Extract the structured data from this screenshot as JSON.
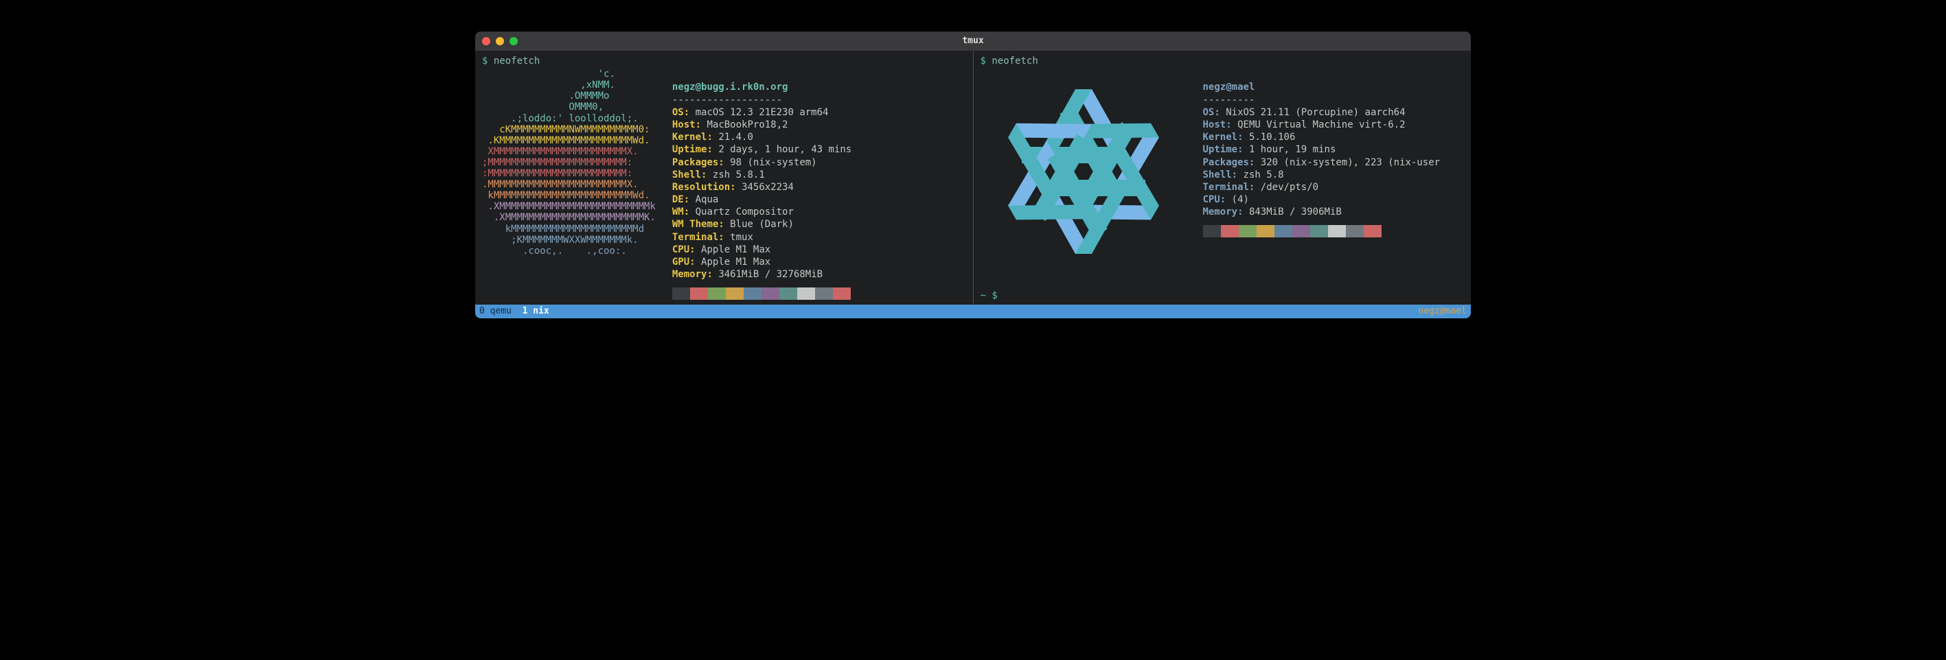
{
  "window": {
    "title": "tmux"
  },
  "left": {
    "command": "neofetch",
    "user_host": "negz@bugg.i.rk0n.org",
    "dashes": "-------------------",
    "info": {
      "OS": "macOS 12.3 21E230 arm64",
      "Host": "MacBookPro18,2",
      "Kernel": "21.4.0",
      "Uptime": "2 days, 1 hour, 43 mins",
      "Packages": "98 (nix-system)",
      "Shell": "zsh 5.8.1",
      "Resolution": "3456x2234",
      "DE": "Aqua",
      "WM": "Quartz Compositor",
      "WM Theme": "Blue (Dark)",
      "Terminal": "tmux",
      "CPU": "Apple M1 Max",
      "GPU": "Apple M1 Max",
      "Memory": "3461MiB / 32768MiB"
    },
    "ascii": [
      "                    'c.",
      "                 ,xNMM.",
      "               .OMMMMo",
      "               OMMM0,",
      "     .;loddo:' loolloddol;.",
      "   cKMMMMMMMMMMNWMMMMMMMMMM0:",
      " .KMMMMMMMMMMMMMMMMMMMMMMMWd.",
      " XMMMMMMMMMMMMMMMMMMMMMMMX.",
      ";MMMMMMMMMMMMMMMMMMMMMMMM:",
      ":MMMMMMMMMMMMMMMMMMMMMMMM:",
      ".MMMMMMMMMMMMMMMMMMMMMMMMX.",
      " kMMMMMMMMMMMMMMMMMMMMMMMMWd.",
      " .XMMMMMMMMMMMMMMMMMMMMMMMMMMk",
      "  .XMMMMMMMMMMMMMMMMMMMMMMMMK.",
      "    kMMMMMMMMMMMMMMMMMMMMMMd",
      "     ;KMMMMMMMWXXWMMMMMMMk.",
      "       .cooc,.    .,coo:."
    ],
    "ascii_colors": [
      "a1",
      "a1",
      "a1",
      "a1",
      "a1",
      "a2",
      "a2",
      "a3",
      "a3",
      "a3",
      "a4",
      "a4",
      "a5",
      "a5",
      "a6",
      "a6",
      "a6"
    ],
    "swatches": [
      "#3b3e42",
      "#cc6666",
      "#7aa05c",
      "#c9a14a",
      "#5f819d",
      "#85678f",
      "#5e8d87",
      "#c5c8c6",
      "#707880",
      "#cc6666"
    ]
  },
  "right": {
    "command": "neofetch",
    "user_host": "negz@mael",
    "dashes": "---------",
    "info": {
      "OS": "NixOS 21.11 (Porcupine) aarch64",
      "Host": "QEMU Virtual Machine virt-6.2",
      "Kernel": "5.10.106",
      "Uptime": "1 hour, 19 mins",
      "Packages": "320 (nix-system), 223 (nix-user",
      "Shell": "zsh 5.8",
      "Terminal": "/dev/pts/0",
      "CPU": "(4)",
      "Memory": "843MiB / 3906MiB"
    },
    "swatches": [
      "#3b3e42",
      "#cc6666",
      "#7aa05c",
      "#c9a14a",
      "#5f819d",
      "#85678f",
      "#5e8d87",
      "#c5c8c6",
      "#707880",
      "#cc6666"
    ],
    "logo_colors": {
      "a": "#4fb3bf",
      "b": "#7ab7e8"
    }
  },
  "status": {
    "tab0_index": "0",
    "tab0_name": "qemu",
    "tab1_index": "1",
    "tab1_name": "nix",
    "right": "negz@mael"
  }
}
